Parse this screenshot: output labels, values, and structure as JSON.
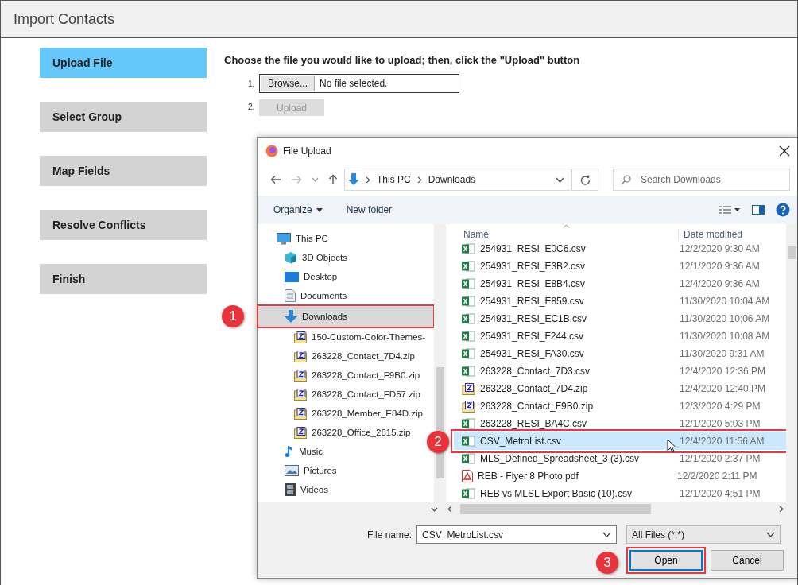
{
  "page": {
    "title": "Import Contacts",
    "steps": [
      {
        "label": "Upload File",
        "selected": true
      },
      {
        "label": "Select Group",
        "selected": false
      },
      {
        "label": "Map Fields",
        "selected": false
      },
      {
        "label": "Resolve Conflicts",
        "selected": false
      },
      {
        "label": "Finish",
        "selected": false
      }
    ],
    "instruction": "Choose the file you would like to upload; then, click the \"Upload\" button",
    "upload": {
      "step_1": "1.",
      "browse_button": "Browse...",
      "file_status": "No file selected.",
      "step_2": "2.",
      "upload_button": "Upload",
      "upload_disabled": true
    }
  },
  "dialog": {
    "title": "File Upload",
    "breadcrumb": [
      "This PC",
      "Downloads"
    ],
    "search": {
      "placeholder": "Search Downloads"
    },
    "toolbar": {
      "organize": "Organize",
      "new_folder": "New folder"
    },
    "nav": [
      {
        "label": "This PC",
        "kind": "pc",
        "selected": false,
        "children": [
          {
            "label": "3D Objects",
            "kind": "cube",
            "selected": false
          },
          {
            "label": "Desktop",
            "kind": "desktop",
            "selected": false
          },
          {
            "label": "Documents",
            "kind": "document",
            "selected": false
          },
          {
            "label": "Downloads",
            "kind": "download",
            "selected": true,
            "callout": "1",
            "children": [
              {
                "label": "150-Custom-Color-Themes-",
                "kind": "zip",
                "selected": false
              },
              {
                "label": "263228_Contact_7D4.zip",
                "kind": "zip",
                "selected": false
              },
              {
                "label": "263228_Contact_F9B0.zip",
                "kind": "zip",
                "selected": false
              },
              {
                "label": "263228_Contact_FD57.zip",
                "kind": "zip",
                "selected": false
              },
              {
                "label": "263228_Member_E84D.zip",
                "kind": "zip",
                "selected": false
              },
              {
                "label": "263228_Office_2815.zip",
                "kind": "zip",
                "selected": false
              }
            ]
          },
          {
            "label": "Music",
            "kind": "music",
            "selected": false
          },
          {
            "label": "Pictures",
            "kind": "pictures",
            "selected": false
          },
          {
            "label": "Videos",
            "kind": "videos",
            "selected": false
          }
        ]
      }
    ],
    "columns": [
      "Name",
      "Date modified"
    ],
    "files": [
      {
        "name": "254931_RESI_E0C6.csv",
        "date": "12/2/2020 9:30 AM",
        "kind": "csv",
        "selected": false
      },
      {
        "name": "254931_RESI_E3B2.csv",
        "date": "12/1/2020 9:36 AM",
        "kind": "csv",
        "selected": false
      },
      {
        "name": "254931_RESI_E8B4.csv",
        "date": "12/4/2020 9:36 AM",
        "kind": "csv",
        "selected": false
      },
      {
        "name": "254931_RESI_E859.csv",
        "date": "11/30/2020 10:04 AM",
        "kind": "csv",
        "selected": false
      },
      {
        "name": "254931_RESI_EC1B.csv",
        "date": "11/30/2020 10:06 AM",
        "kind": "csv",
        "selected": false
      },
      {
        "name": "254931_RESI_F244.csv",
        "date": "11/30/2020 10:08 AM",
        "kind": "csv",
        "selected": false
      },
      {
        "name": "254931_RESI_FA30.csv",
        "date": "11/30/2020 9:31 AM",
        "kind": "csv",
        "selected": false
      },
      {
        "name": "263228_Contact_7D3.csv",
        "date": "12/4/2020 12:36 PM",
        "kind": "csv",
        "selected": false
      },
      {
        "name": "263228_Contact_7D4.zip",
        "date": "12/4/2020 12:40 PM",
        "kind": "zip",
        "selected": false
      },
      {
        "name": "263228_Contact_F9B0.zip",
        "date": "12/3/2020 4:29 PM",
        "kind": "zip",
        "selected": false
      },
      {
        "name": "263228_RESI_BA4C.csv",
        "date": "12/1/2020 5:03 PM",
        "kind": "csv",
        "selected": false
      },
      {
        "name": "CSV_MetroList.csv",
        "date": "12/4/2020 11:56 AM",
        "kind": "csv",
        "selected": true,
        "callout": "2"
      },
      {
        "name": "MLS_Defined_Spreadsheet_3 (3).csv",
        "date": "12/1/2020 2:37 PM",
        "kind": "csv",
        "selected": false
      },
      {
        "name": "REB - Flyer 8 Photo.pdf",
        "date": "12/2/2020 2:11 PM",
        "kind": "pdf",
        "selected": false
      },
      {
        "name": "REB vs MLSL Export Basic (10).csv",
        "date": "12/1/2020 4:51 PM",
        "kind": "csv",
        "selected": false
      }
    ],
    "file_name_label": "File name:",
    "file_name": "CSV_MetroList.csv",
    "file_type": "All Files (*.*)",
    "open_button": {
      "label": "Open",
      "callout": "3"
    },
    "cancel_button": "Cancel"
  }
}
